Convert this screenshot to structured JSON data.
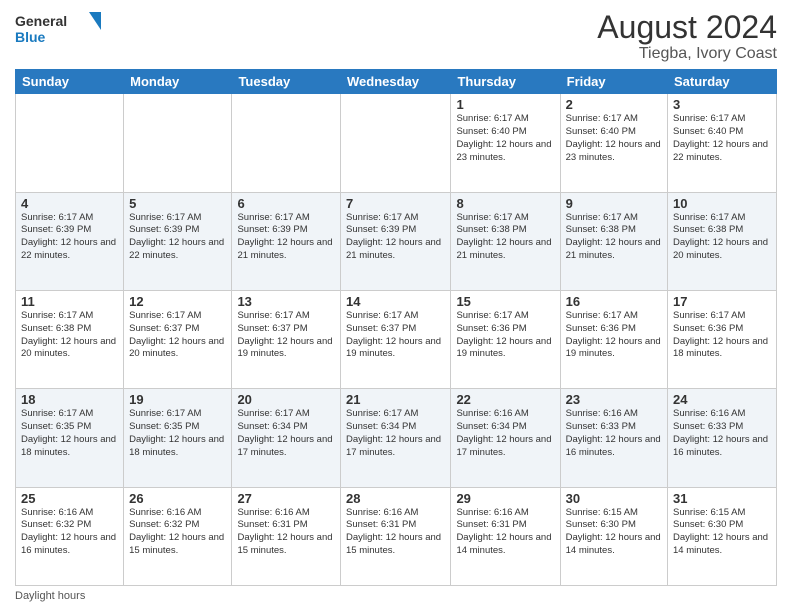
{
  "logo": {
    "line1": "General",
    "line2": "Blue"
  },
  "title": "August 2024",
  "subtitle": "Tiegba, Ivory Coast",
  "days_of_week": [
    "Sunday",
    "Monday",
    "Tuesday",
    "Wednesday",
    "Thursday",
    "Friday",
    "Saturday"
  ],
  "weeks": [
    [
      {
        "day": "",
        "info": ""
      },
      {
        "day": "",
        "info": ""
      },
      {
        "day": "",
        "info": ""
      },
      {
        "day": "",
        "info": ""
      },
      {
        "day": "1",
        "info": "Sunrise: 6:17 AM\nSunset: 6:40 PM\nDaylight: 12 hours\nand 23 minutes."
      },
      {
        "day": "2",
        "info": "Sunrise: 6:17 AM\nSunset: 6:40 PM\nDaylight: 12 hours\nand 23 minutes."
      },
      {
        "day": "3",
        "info": "Sunrise: 6:17 AM\nSunset: 6:40 PM\nDaylight: 12 hours\nand 22 minutes."
      }
    ],
    [
      {
        "day": "4",
        "info": "Sunrise: 6:17 AM\nSunset: 6:39 PM\nDaylight: 12 hours\nand 22 minutes."
      },
      {
        "day": "5",
        "info": "Sunrise: 6:17 AM\nSunset: 6:39 PM\nDaylight: 12 hours\nand 22 minutes."
      },
      {
        "day": "6",
        "info": "Sunrise: 6:17 AM\nSunset: 6:39 PM\nDaylight: 12 hours\nand 21 minutes."
      },
      {
        "day": "7",
        "info": "Sunrise: 6:17 AM\nSunset: 6:39 PM\nDaylight: 12 hours\nand 21 minutes."
      },
      {
        "day": "8",
        "info": "Sunrise: 6:17 AM\nSunset: 6:38 PM\nDaylight: 12 hours\nand 21 minutes."
      },
      {
        "day": "9",
        "info": "Sunrise: 6:17 AM\nSunset: 6:38 PM\nDaylight: 12 hours\nand 21 minutes."
      },
      {
        "day": "10",
        "info": "Sunrise: 6:17 AM\nSunset: 6:38 PM\nDaylight: 12 hours\nand 20 minutes."
      }
    ],
    [
      {
        "day": "11",
        "info": "Sunrise: 6:17 AM\nSunset: 6:38 PM\nDaylight: 12 hours\nand 20 minutes."
      },
      {
        "day": "12",
        "info": "Sunrise: 6:17 AM\nSunset: 6:37 PM\nDaylight: 12 hours\nand 20 minutes."
      },
      {
        "day": "13",
        "info": "Sunrise: 6:17 AM\nSunset: 6:37 PM\nDaylight: 12 hours\nand 19 minutes."
      },
      {
        "day": "14",
        "info": "Sunrise: 6:17 AM\nSunset: 6:37 PM\nDaylight: 12 hours\nand 19 minutes."
      },
      {
        "day": "15",
        "info": "Sunrise: 6:17 AM\nSunset: 6:36 PM\nDaylight: 12 hours\nand 19 minutes."
      },
      {
        "day": "16",
        "info": "Sunrise: 6:17 AM\nSunset: 6:36 PM\nDaylight: 12 hours\nand 19 minutes."
      },
      {
        "day": "17",
        "info": "Sunrise: 6:17 AM\nSunset: 6:36 PM\nDaylight: 12 hours\nand 18 minutes."
      }
    ],
    [
      {
        "day": "18",
        "info": "Sunrise: 6:17 AM\nSunset: 6:35 PM\nDaylight: 12 hours\nand 18 minutes."
      },
      {
        "day": "19",
        "info": "Sunrise: 6:17 AM\nSunset: 6:35 PM\nDaylight: 12 hours\nand 18 minutes."
      },
      {
        "day": "20",
        "info": "Sunrise: 6:17 AM\nSunset: 6:34 PM\nDaylight: 12 hours\nand 17 minutes."
      },
      {
        "day": "21",
        "info": "Sunrise: 6:17 AM\nSunset: 6:34 PM\nDaylight: 12 hours\nand 17 minutes."
      },
      {
        "day": "22",
        "info": "Sunrise: 6:16 AM\nSunset: 6:34 PM\nDaylight: 12 hours\nand 17 minutes."
      },
      {
        "day": "23",
        "info": "Sunrise: 6:16 AM\nSunset: 6:33 PM\nDaylight: 12 hours\nand 16 minutes."
      },
      {
        "day": "24",
        "info": "Sunrise: 6:16 AM\nSunset: 6:33 PM\nDaylight: 12 hours\nand 16 minutes."
      }
    ],
    [
      {
        "day": "25",
        "info": "Sunrise: 6:16 AM\nSunset: 6:32 PM\nDaylight: 12 hours\nand 16 minutes."
      },
      {
        "day": "26",
        "info": "Sunrise: 6:16 AM\nSunset: 6:32 PM\nDaylight: 12 hours\nand 15 minutes."
      },
      {
        "day": "27",
        "info": "Sunrise: 6:16 AM\nSunset: 6:31 PM\nDaylight: 12 hours\nand 15 minutes."
      },
      {
        "day": "28",
        "info": "Sunrise: 6:16 AM\nSunset: 6:31 PM\nDaylight: 12 hours\nand 15 minutes."
      },
      {
        "day": "29",
        "info": "Sunrise: 6:16 AM\nSunset: 6:31 PM\nDaylight: 12 hours\nand 14 minutes."
      },
      {
        "day": "30",
        "info": "Sunrise: 6:15 AM\nSunset: 6:30 PM\nDaylight: 12 hours\nand 14 minutes."
      },
      {
        "day": "31",
        "info": "Sunrise: 6:15 AM\nSunset: 6:30 PM\nDaylight: 12 hours\nand 14 minutes."
      }
    ]
  ],
  "footer": "Daylight hours"
}
